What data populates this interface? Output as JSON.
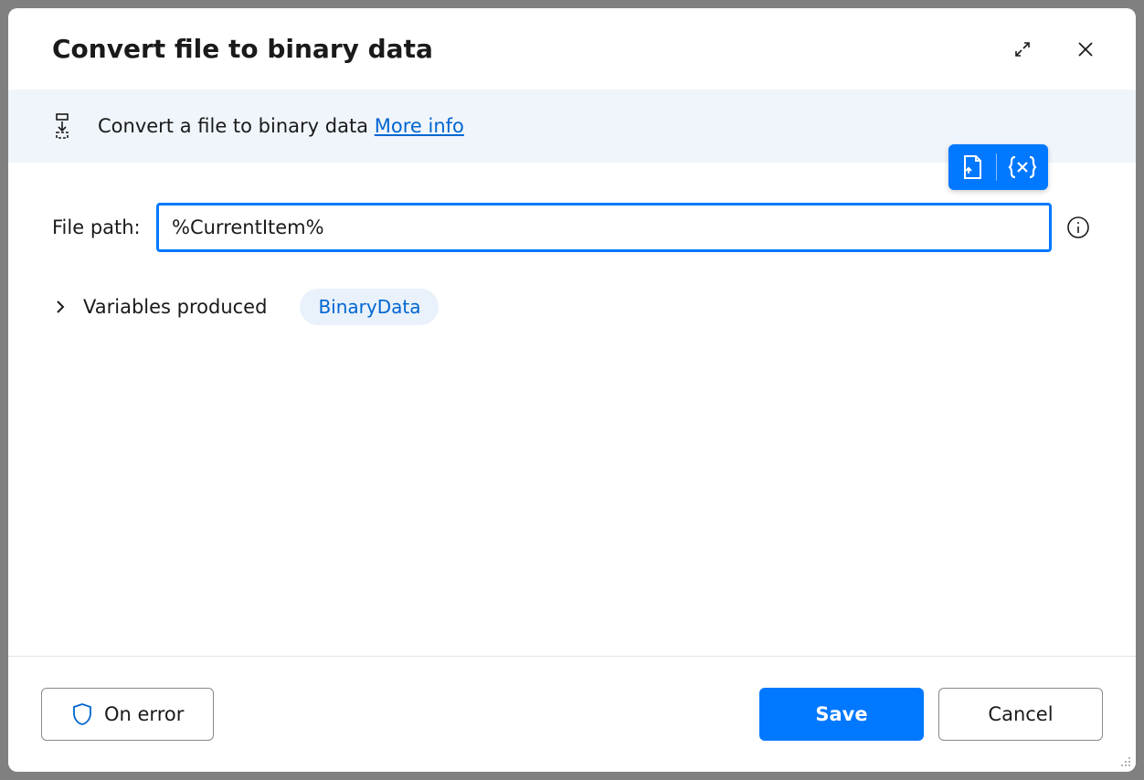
{
  "header": {
    "title": "Convert file to binary data"
  },
  "banner": {
    "text": "Convert a file to binary data",
    "link_label": "More info"
  },
  "field": {
    "label": "File path:",
    "value": "%CurrentItem%"
  },
  "variables": {
    "label": "Variables produced",
    "chip": "BinaryData"
  },
  "footer": {
    "on_error_label": "On error",
    "save_label": "Save",
    "cancel_label": "Cancel"
  }
}
